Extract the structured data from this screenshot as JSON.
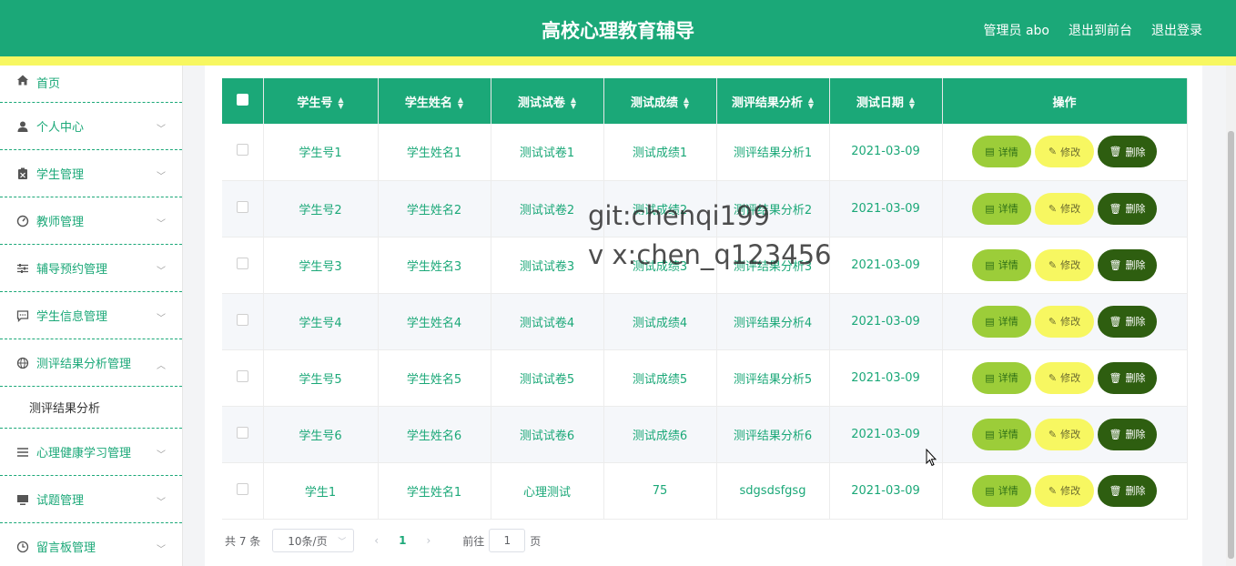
{
  "header": {
    "title": "高校心理教育辅导",
    "admin": "管理员 abo",
    "to_front": "退出到前台",
    "logout": "退出登录"
  },
  "sidebar": {
    "items": [
      {
        "label": "首页",
        "icon": "home-icon"
      },
      {
        "label": "个人中心",
        "icon": "user-icon"
      },
      {
        "label": "学生管理",
        "icon": "clipboard-icon"
      },
      {
        "label": "教师管理",
        "icon": "gauge-icon"
      },
      {
        "label": "辅导预约管理",
        "icon": "sliders-icon"
      },
      {
        "label": "学生信息管理",
        "icon": "chat-icon"
      },
      {
        "label": "测评结果分析管理",
        "icon": "globe-icon"
      },
      {
        "label": "测评结果分析",
        "icon": ""
      },
      {
        "label": "心理健康学习管理",
        "icon": "list-icon"
      },
      {
        "label": "试题管理",
        "icon": "monitor-icon"
      },
      {
        "label": "留言板管理",
        "icon": "clock-icon"
      }
    ]
  },
  "table": {
    "columns": [
      "学生号",
      "学生姓名",
      "测试试卷",
      "测试成绩",
      "测评结果分析",
      "测试日期",
      "操作"
    ],
    "rows": [
      [
        "学生号1",
        "学生姓名1",
        "测试试卷1",
        "测试成绩1",
        "测评结果分析1",
        "2021-03-09"
      ],
      [
        "学生号2",
        "学生姓名2",
        "测试试卷2",
        "测试成绩2",
        "测评结果分析2",
        "2021-03-09"
      ],
      [
        "学生号3",
        "学生姓名3",
        "测试试卷3",
        "测试成绩3",
        "测评结果分析3",
        "2021-03-09"
      ],
      [
        "学生号4",
        "学生姓名4",
        "测试试卷4",
        "测试成绩4",
        "测评结果分析4",
        "2021-03-09"
      ],
      [
        "学生号5",
        "学生姓名5",
        "测试试卷5",
        "测试成绩5",
        "测评结果分析5",
        "2021-03-09"
      ],
      [
        "学生号6",
        "学生姓名6",
        "测试试卷6",
        "测试成绩6",
        "测评结果分析6",
        "2021-03-09"
      ],
      [
        "学生1",
        "学生姓名1",
        "心理测试",
        "75",
        "sdgsdsfgsg",
        "2021-03-09"
      ]
    ],
    "actions": {
      "detail": "详情",
      "edit": "修改",
      "delete": "删除"
    }
  },
  "watermark": {
    "line1": "git:chenqi199",
    "line2": "v x:chen_q123456"
  },
  "pager": {
    "total": "共 7 条",
    "page_size": "10条/页",
    "current_page": "1",
    "goto_prefix": "前往",
    "goto_value": "1",
    "goto_suffix": "页"
  },
  "colors": {
    "primary": "#1ba878",
    "accent_yellow": "#f7f761",
    "detail_button": "#9ccd39",
    "delete_button": "#2e5e10"
  }
}
